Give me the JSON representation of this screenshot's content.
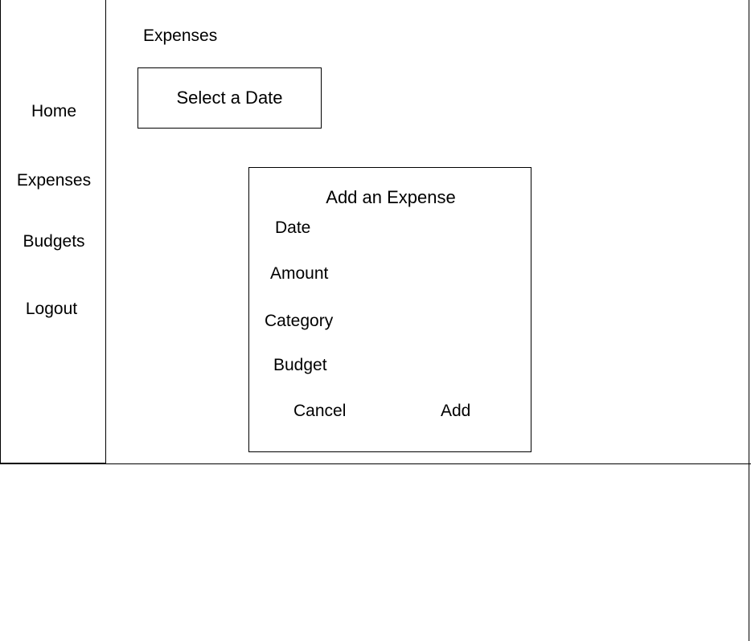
{
  "sidebar": {
    "items": [
      {
        "label": "Home"
      },
      {
        "label": "Expenses"
      },
      {
        "label": "Budgets"
      },
      {
        "label": "Logout"
      }
    ]
  },
  "main": {
    "title": "Expenses",
    "date_button_label": "Select a Date"
  },
  "dialog": {
    "title": "Add an Expense",
    "fields": [
      {
        "label": "Date"
      },
      {
        "label": "Amount"
      },
      {
        "label": "Category"
      },
      {
        "label": "Budget"
      }
    ],
    "cancel_label": "Cancel",
    "add_label": "Add"
  }
}
